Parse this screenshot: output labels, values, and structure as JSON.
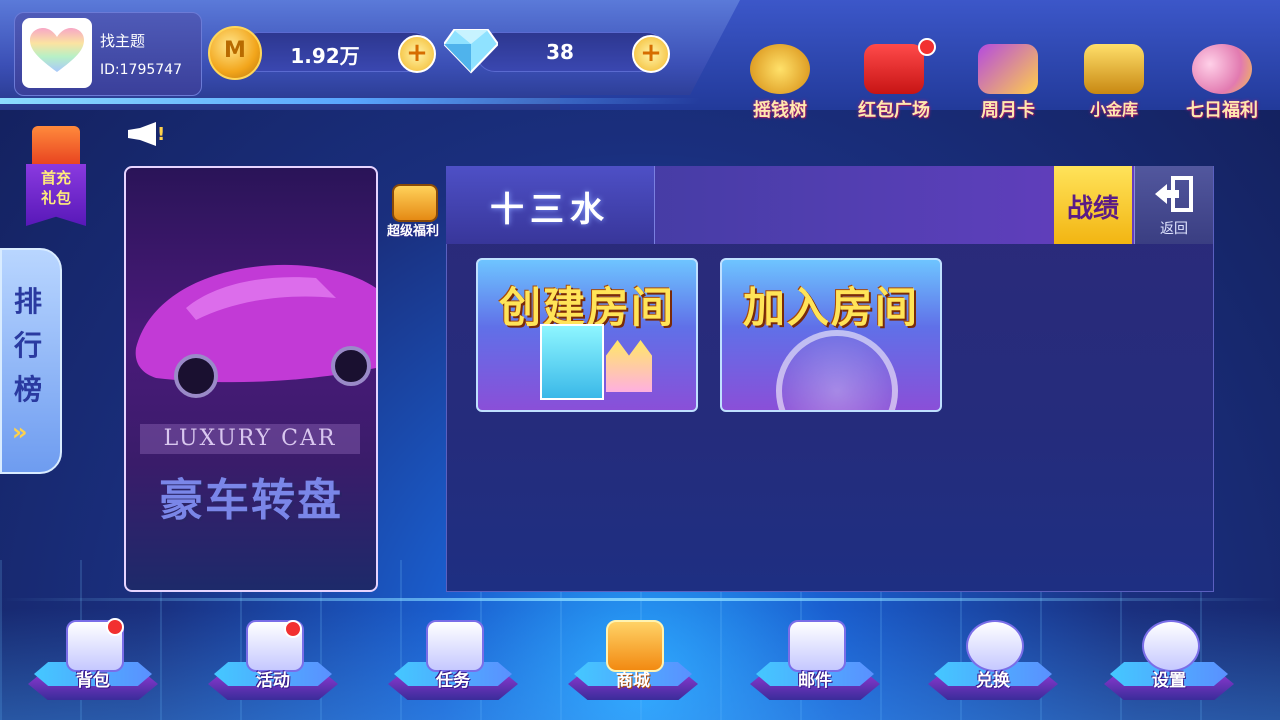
{
  "header": {
    "nickname": "找主题",
    "user_id": "ID:1795747",
    "gold": "1.92万",
    "diamonds": "38",
    "icons": [
      {
        "label": "摇钱树",
        "icon": "money-tree-icon",
        "has_dot": false
      },
      {
        "label": "红包广场",
        "icon": "red-envelope-icon",
        "has_dot": true
      },
      {
        "label": "周月卡",
        "icon": "month-card-icon",
        "has_dot": false
      },
      {
        "label": "小金库",
        "icon": "vault-icon",
        "has_dot": false
      },
      {
        "label": "七日福利",
        "icon": "balloons-icon",
        "has_dot": false
      }
    ]
  },
  "left": {
    "first_charge_line1": "首充",
    "first_charge_line2": "礼包",
    "ranking_label": "排行榜",
    "ranking_arrow": "»"
  },
  "banner": {
    "en_text": "LUXURY CAR",
    "cn_text": "豪车转盘"
  },
  "super_bonus": "超级福利",
  "panel": {
    "title": "十三水",
    "record_label": "战绩",
    "back_label": "返回",
    "create_room": "创建房间",
    "join_room": "加入房间"
  },
  "bottom_nav": [
    {
      "label": "背包",
      "icon": "backpack-icon",
      "has_dot": true
    },
    {
      "label": "活动",
      "icon": "activity-icon",
      "has_dot": true
    },
    {
      "label": "任务",
      "icon": "task-icon",
      "has_dot": false
    },
    {
      "label": "商城",
      "icon": "shop-cart-icon",
      "has_dot": false
    },
    {
      "label": "邮件",
      "icon": "mail-icon",
      "has_dot": false
    },
    {
      "label": "兑换",
      "icon": "exchange-icon",
      "has_dot": false
    },
    {
      "label": "设置",
      "icon": "gear-icon",
      "has_dot": false
    }
  ],
  "colors": {
    "accent_gold": "#ffe458",
    "badge_red": "#f23030",
    "panel_bg": "#2c2a7a"
  }
}
